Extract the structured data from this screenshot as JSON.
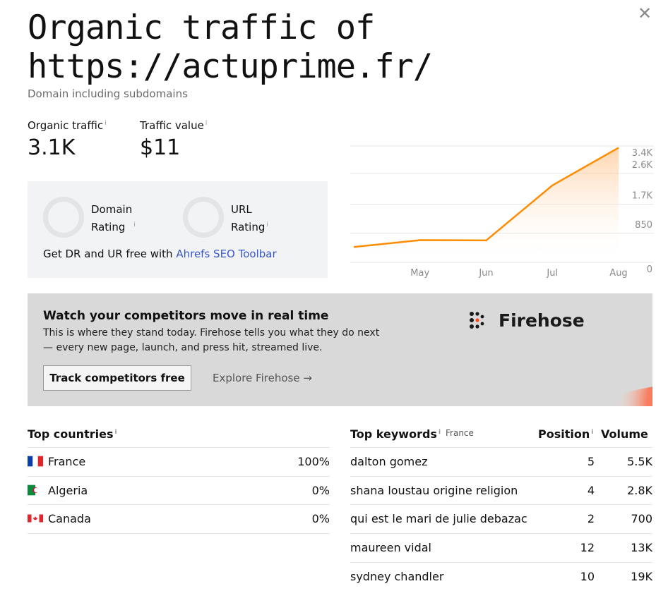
{
  "header": {
    "title": "Organic traffic of https://actuprime.fr/",
    "subtitle": "Domain including subdomains",
    "close_icon": "close-icon"
  },
  "metrics": {
    "organic_traffic_label": "Organic traffic",
    "organic_traffic_value": "3.1K",
    "traffic_value_label": "Traffic value",
    "traffic_value_value": "$11",
    "info_mark": "i"
  },
  "ratings": {
    "domain_line1": "Domain",
    "domain_line2": "Rating",
    "url_line1": "URL",
    "url_line2": "Rating",
    "footer_text": "Get DR and UR free with ",
    "footer_link": "Ahrefs SEO Toolbar"
  },
  "chart_data": {
    "type": "area",
    "title": "",
    "x": [
      "",
      "May",
      "Jun",
      "Jul",
      "Aug"
    ],
    "categories_visible": [
      "May",
      "Jun",
      "Jul",
      "Aug"
    ],
    "series": [
      {
        "values": [
          450,
          650,
          640,
          2250,
          3350
        ]
      }
    ],
    "y_ticks": [
      "3.4K",
      "2.6K",
      "1.7K",
      "850",
      "0"
    ],
    "y_tick_values": [
      3400,
      2600,
      1700,
      850,
      0
    ],
    "ylim": [
      0,
      3400
    ],
    "grid": true,
    "axis_side": "right",
    "line_color": "#ff8c00"
  },
  "banner": {
    "heading": "Watch your competitors move in real time",
    "text": "This is where they stand today. Firehose tells you what they do next — every new page, launch, and press hit, streamed live.",
    "button": "Track competitors free",
    "link": "Explore Firehose →",
    "brand": "Firehose",
    "logo_icon": "firehose-logo-icon"
  },
  "countries": {
    "title": "Top countries",
    "rows": [
      {
        "name": "France",
        "pct": "100%",
        "flag": "flag-fr-icon"
      },
      {
        "name": "Algeria",
        "pct": "0%",
        "flag": "flag-dz-icon"
      },
      {
        "name": "Canada",
        "pct": "0%",
        "flag": "flag-ca-icon"
      }
    ]
  },
  "keywords": {
    "title": "Top keywords",
    "country": "France",
    "position_header": "Position",
    "volume_header": "Volume",
    "rows": [
      {
        "keyword": "dalton gomez",
        "position": "5",
        "volume": "5.5K"
      },
      {
        "keyword": "shana loustau origine religion",
        "position": "4",
        "volume": "2.8K"
      },
      {
        "keyword": "qui est le mari de julie debazac",
        "position": "2",
        "volume": "700"
      },
      {
        "keyword": "maureen vidal",
        "position": "12",
        "volume": "13K"
      },
      {
        "keyword": "sydney chandler",
        "position": "10",
        "volume": "19K"
      }
    ]
  }
}
